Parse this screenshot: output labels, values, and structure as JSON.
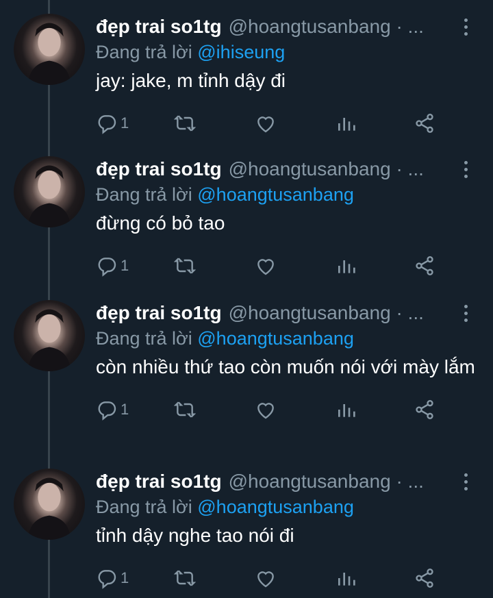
{
  "tweets": [
    {
      "name": "đẹp trai so1tg",
      "handle": "@hoangtusanbang · ...",
      "reply_prefix": "Đang trả lời ",
      "reply_to": "@ihiseung",
      "text": "jay: jake, m tỉnh dậy đi",
      "reply_count": "1"
    },
    {
      "name": "đẹp trai so1tg",
      "handle": "@hoangtusanbang · ...",
      "reply_prefix": "Đang trả lời ",
      "reply_to": "@hoangtusanbang",
      "text": "đừng có bỏ tao",
      "reply_count": "1"
    },
    {
      "name": "đẹp trai so1tg",
      "handle": "@hoangtusanbang · ...",
      "reply_prefix": "Đang trả lời ",
      "reply_to": "@hoangtusanbang",
      "text": "còn nhiều thứ tao còn muốn nói với mày lắm",
      "reply_count": "1"
    },
    {
      "name": "đẹp trai so1tg",
      "handle": "@hoangtusanbang · ...",
      "reply_prefix": "Đang trả lời ",
      "reply_to": "@hoangtusanbang",
      "text": "tỉnh dậy nghe tao nói đi",
      "reply_count": "1"
    }
  ],
  "colors": {
    "background": "#15202b",
    "secondary_text": "#8899a6",
    "mention": "#1da1f2",
    "thread_line": "#38444d"
  },
  "icons": [
    "reply-icon",
    "retweet-icon",
    "like-icon",
    "analytics-icon",
    "share-icon",
    "more-icon"
  ]
}
